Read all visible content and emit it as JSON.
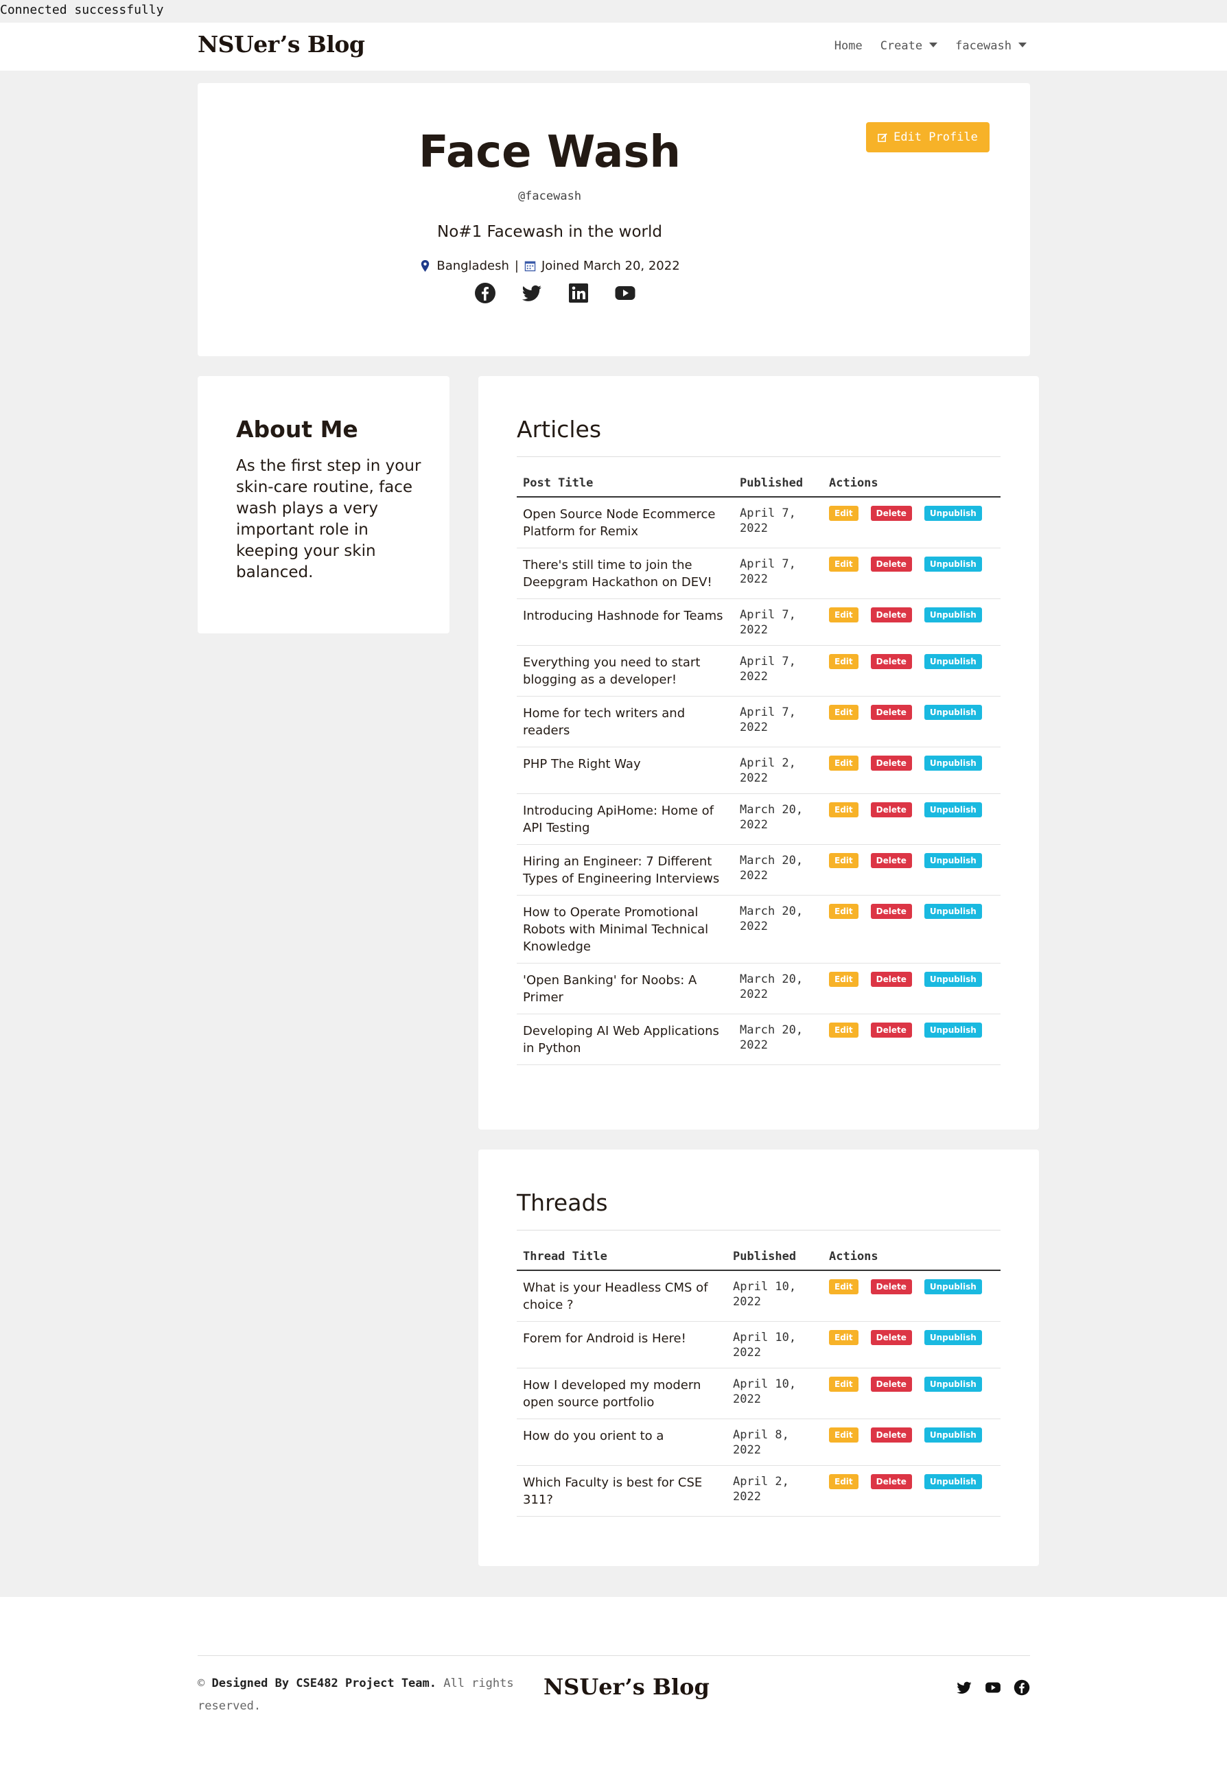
{
  "status": "Connected successfully",
  "nav": {
    "brand": "NSUer’s Blog",
    "links": [
      "Home",
      "Create",
      "facewash"
    ]
  },
  "profile": {
    "edit_button": "Edit Profile",
    "name": "Face Wash",
    "handle": "@facewash",
    "bio": "No#1 Facewash in the world",
    "location": "Bangladesh",
    "separator": "|",
    "joined": "Joined March 20, 2022",
    "socials": [
      "facebook-icon",
      "twitter-icon",
      "linkedin-icon",
      "youtube-icon"
    ]
  },
  "about": {
    "title": "About Me",
    "text": "As the first step in your skin-care routine, face wash plays a very important role in keeping your skin balanced."
  },
  "articles": {
    "title": "Articles",
    "headers": [
      "Post Title",
      "Published",
      "Actions"
    ],
    "actions": [
      "Edit",
      "Delete",
      "Unpublish"
    ],
    "rows": [
      {
        "title": "Open Source Node Ecommerce Platform for Remix",
        "date": "April 7, 2022"
      },
      {
        "title": "There's still time to join the Deepgram Hackathon on DEV!",
        "date": "April 7, 2022"
      },
      {
        "title": "Introducing Hashnode for Teams",
        "date": "April 7, 2022"
      },
      {
        "title": "Everything you need to start blogging as a developer!",
        "date": "April 7, 2022"
      },
      {
        "title": "Home for tech writers and readers",
        "date": "April 7, 2022"
      },
      {
        "title": "PHP The Right Way",
        "date": "April 2, 2022"
      },
      {
        "title": "Introducing ApiHome: Home of API Testing",
        "date": "March 20, 2022"
      },
      {
        "title": "Hiring an Engineer: 7 Different Types of Engineering Interviews",
        "date": "March 20, 2022"
      },
      {
        "title": "How to Operate Promotional Robots with Minimal Technical Knowledge",
        "date": "March 20, 2022"
      },
      {
        "title": "'Open Banking' for Noobs: A Primer",
        "date": "March 20, 2022"
      },
      {
        "title": "Developing AI Web Applications in Python",
        "date": "March 20, 2022"
      }
    ]
  },
  "threads": {
    "title": "Threads",
    "headers": [
      "Thread Title",
      "Published",
      "Actions"
    ],
    "actions": [
      "Edit",
      "Delete",
      "Unpublish"
    ],
    "rows": [
      {
        "title": "What is your Headless CMS of choice ?",
        "date": "April 10, 2022"
      },
      {
        "title": "Forem for Android is Here!",
        "date": "April 10, 2022"
      },
      {
        "title": "How I developed my modern open source portfolio",
        "date": "April 10, 2022"
      },
      {
        "title": "How do you orient to a",
        "date": "April 8, 2022"
      },
      {
        "title": "Which Faculty is best for CSE 311?",
        "date": "April 2, 2022"
      }
    ]
  },
  "footer": {
    "copy_prefix": "© ",
    "copy_bold": "Designed By CSE482 Project Team.",
    "copy_rest": " All rights reserved.",
    "brand": "NSUer’s Blog",
    "socials": [
      "twitter-icon",
      "youtube-icon",
      "facebook-icon"
    ]
  },
  "colors": {
    "edit": "#f7b228",
    "delete": "#dc3545",
    "unpublish": "#1ab9e0",
    "text": "#231a14"
  }
}
